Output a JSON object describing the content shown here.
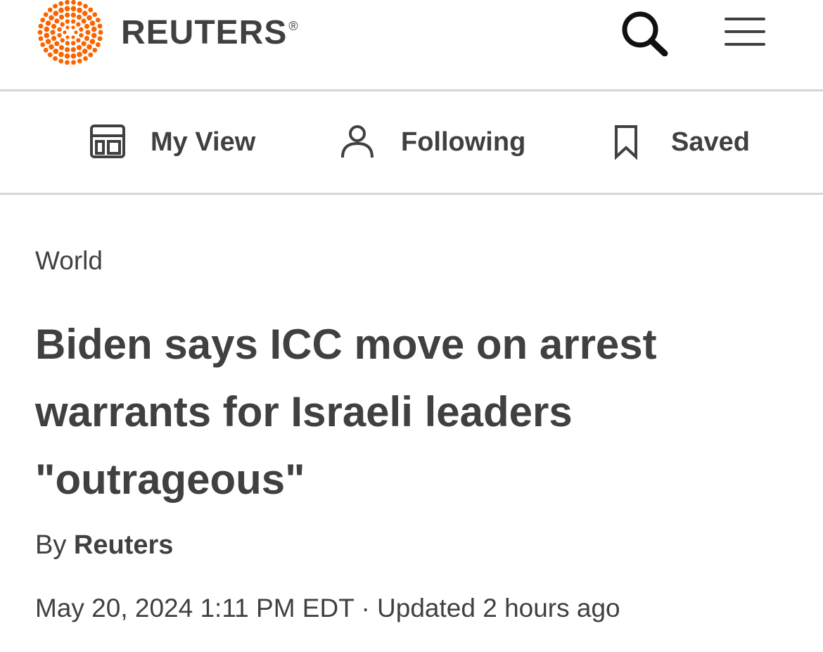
{
  "header": {
    "brand_name": "REUTERS",
    "brand_reg": "®",
    "brand_color": "#fa6400",
    "search_icon": "search-icon",
    "menu_icon": "hamburger-menu-icon"
  },
  "nav": {
    "items": [
      {
        "label": "My View",
        "icon": "layout-icon"
      },
      {
        "label": "Following",
        "icon": "person-icon"
      },
      {
        "label": "Saved",
        "icon": "bookmark-icon"
      }
    ]
  },
  "article": {
    "section": "World",
    "headline": "Biden says ICC move on arrest warrants for Israeli leaders \"outrageous\"",
    "byline_prefix": "By",
    "byline_author": "Reuters",
    "date": "May 20, 2024 1:11 PM EDT",
    "separator": "·",
    "updated": "Updated 2 hours ago"
  }
}
